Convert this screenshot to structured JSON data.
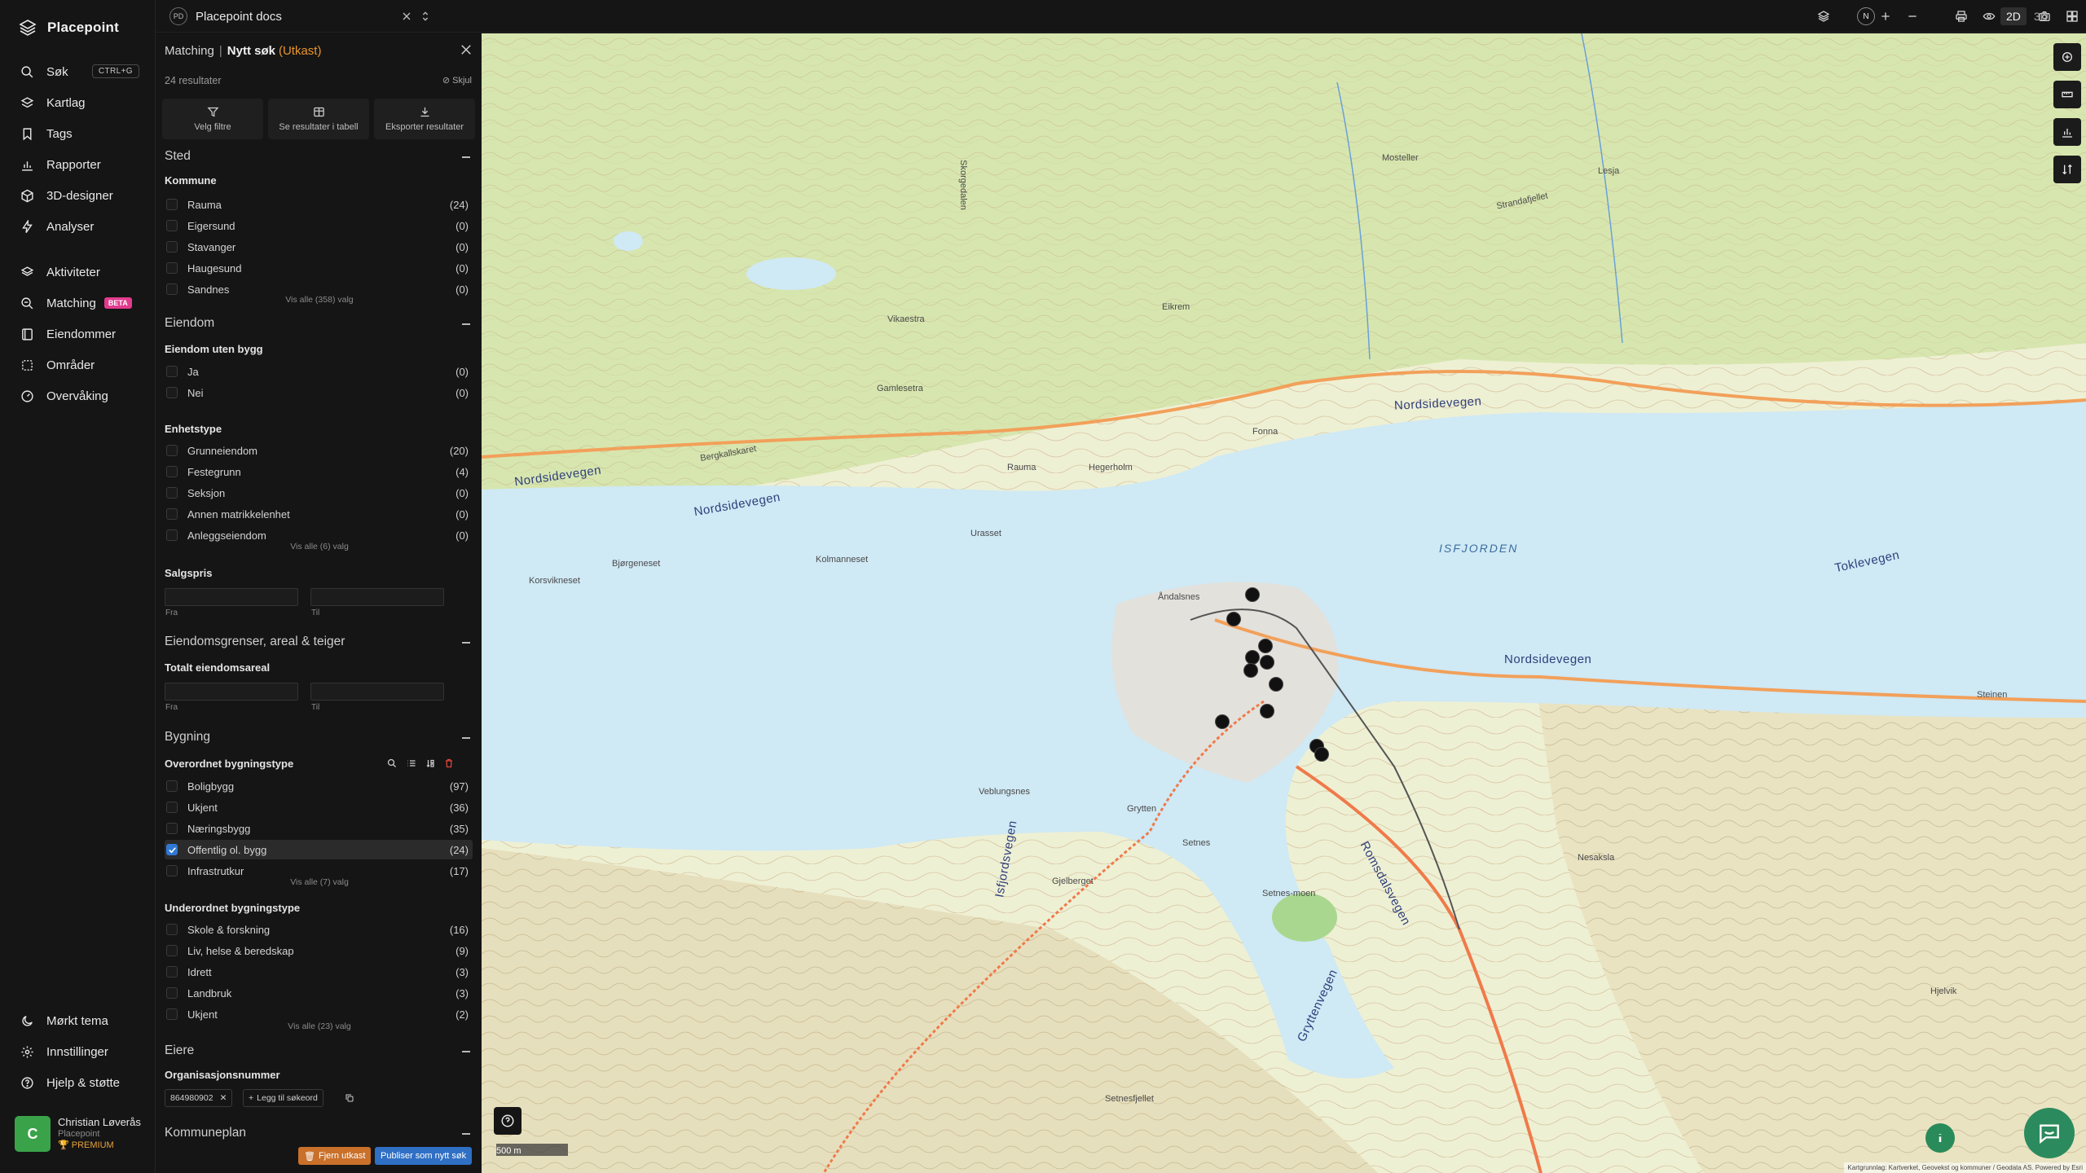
{
  "brand": {
    "name": "Placepoint"
  },
  "nav": {
    "search": {
      "label": "Søk",
      "shortcut": "CTRL+G"
    },
    "items": [
      {
        "label": "Kartlag"
      },
      {
        "label": "Tags"
      },
      {
        "label": "Rapporter"
      },
      {
        "label": "3D-designer"
      },
      {
        "label": "Analyser"
      },
      {
        "label": "Aktiviteter"
      },
      {
        "label": "Matching",
        "badge": "BETA"
      },
      {
        "label": "Eiendommer"
      },
      {
        "label": "Områder"
      },
      {
        "label": "Overvåking"
      }
    ],
    "bottom": [
      {
        "label": "Mørkt tema"
      },
      {
        "label": "Innstillinger"
      },
      {
        "label": "Hjelp & støtte"
      }
    ],
    "user": {
      "initial": "C",
      "name": "Christian Løverås",
      "company": "Placepoint",
      "plan": "PREMIUM"
    }
  },
  "topbar": {
    "workspace_initials": "PD",
    "workspace": "Placepoint docs",
    "north": "N",
    "mode_2d": "2D",
    "mode_3d": "3D"
  },
  "panel": {
    "crumb": "Matching",
    "title": "Nytt søk",
    "status": "(Utkast)",
    "result_count": "24 resultater",
    "hide_label": "Skjul",
    "actions": [
      "Velg filtre",
      "Se resultater i tabell",
      "Eksporter resultater"
    ],
    "sted": {
      "title": "Sted",
      "kommune_label": "Kommune",
      "kommuner": [
        {
          "label": "Rauma",
          "count": "(24)"
        },
        {
          "label": "Eigersund",
          "count": "(0)"
        },
        {
          "label": "Stavanger",
          "count": "(0)"
        },
        {
          "label": "Haugesund",
          "count": "(0)"
        },
        {
          "label": "Sandnes",
          "count": "(0)"
        }
      ],
      "show_all": "Vis alle (358) valg"
    },
    "eiendom": {
      "title": "Eiendom",
      "uten_bygg_label": "Eiendom uten bygg",
      "uten_bygg": [
        {
          "label": "Ja",
          "count": "(0)"
        },
        {
          "label": "Nei",
          "count": "(0)"
        }
      ],
      "enhetstype_label": "Enhetstype",
      "enhetstyper": [
        {
          "label": "Grunneiendom",
          "count": "(20)"
        },
        {
          "label": "Festegrunn",
          "count": "(4)"
        },
        {
          "label": "Seksjon",
          "count": "(0)"
        },
        {
          "label": "Annen matrikkelenhet",
          "count": "(0)"
        },
        {
          "label": "Anleggseiendom",
          "count": "(0)"
        }
      ],
      "show_all": "Vis alle (6) valg",
      "salgspris_label": "Salgspris",
      "from_label": "Fra",
      "to_label": "Til"
    },
    "grenser": {
      "title": "Eiendomsgrenser, areal & teiger",
      "areal_label": "Totalt eiendomsareal",
      "from_label": "Fra",
      "to_label": "Til"
    },
    "bygning": {
      "title": "Bygning",
      "overordnet_label": "Overordnet bygningstype",
      "overordnet": [
        {
          "label": "Boligbygg",
          "count": "(97)"
        },
        {
          "label": "Ukjent",
          "count": "(36)"
        },
        {
          "label": "Næringsbygg",
          "count": "(35)"
        },
        {
          "label": "Offentlig ol. bygg",
          "count": "(24)",
          "checked": true
        },
        {
          "label": "Infrastrutkur",
          "count": "(17)"
        }
      ],
      "overordnet_show_all": "Vis alle (7) valg",
      "underordnet_label": "Underordnet bygningstype",
      "underordnet": [
        {
          "label": "Skole & forskning",
          "count": "(16)"
        },
        {
          "label": "Liv, helse & beredskap",
          "count": "(9)"
        },
        {
          "label": "Idrett",
          "count": "(3)"
        },
        {
          "label": "Landbruk",
          "count": "(3)"
        },
        {
          "label": "Ukjent",
          "count": "(2)"
        }
      ],
      "underordnet_show_all": "Vis alle (23) valg"
    },
    "eiere": {
      "title": "Eiere",
      "org_label": "Organisasjonsnummer",
      "org_chip": "864980902",
      "add_keyword": "Legg til søkeord"
    },
    "kommuneplan": {
      "title": "Kommuneplan"
    },
    "footer": {
      "remove": "Fjern utkast",
      "publish": "Publiser som nytt søk"
    }
  },
  "map": {
    "labels": {
      "nordsidevegen": "Nordsidevegen",
      "isfjorden": "ISFJORDEN",
      "andalsnes": "Åndalsnes",
      "romsdalsvegen": "Romsdalsvegen",
      "veblungsnes": "Veblungsnes",
      "setnesfjellet": "Setnesfjellet",
      "rauma": "Rauma",
      "toklevegen": "Toklevegen",
      "strandafjellet": "Strandafjellet",
      "bjorgeneset": "Bjørgeneset",
      "kolmanneset": "Kolmanneset",
      "urasset": "Urasset",
      "hegerholm": "Hegerholm",
      "fonna": "Fonna",
      "steinen": "Steinen",
      "nesaksla": "Nesaksla",
      "grytten": "Grytten",
      "gryttenvegen": "Gryttenvegen",
      "korsvikneset": "Korsvikneset",
      "isfjordsvegen": "Isfjordsvegen",
      "setnes": "Setnes",
      "lesjanger": "Lesja",
      "skorge": "Skorgedalen",
      "vikaestra": "Vikaestra",
      "gamlesetra": "Gamlesetra",
      "bergkallskaret": "Bergkallskaret",
      "eikrem": "Eikrem",
      "mosteller": "Mosteller",
      "setnesmoen": "Setnes-moen",
      "veblungsberget": "Gjelberget",
      "hjelvik": "Hjelvik"
    },
    "scale": "500 m",
    "attribution": "Kartgrunnlag: Kartverket, Geovekst og kommuner / Geodata AS. Powered by Esri"
  },
  "colors": {
    "accent_orange": "#e9942d",
    "beta_pink": "#e23b8e",
    "check_blue": "#2f78d3",
    "user_green": "#3aa34a",
    "water": "#cfe9f5",
    "land": "#e7ecc9"
  },
  "icons": {
    "search": "search-icon",
    "layers": "layers-icon",
    "bookmark": "bookmark-icon",
    "chart": "bar-chart-icon",
    "cube": "cube-icon",
    "bolt": "bolt-icon"
  }
}
